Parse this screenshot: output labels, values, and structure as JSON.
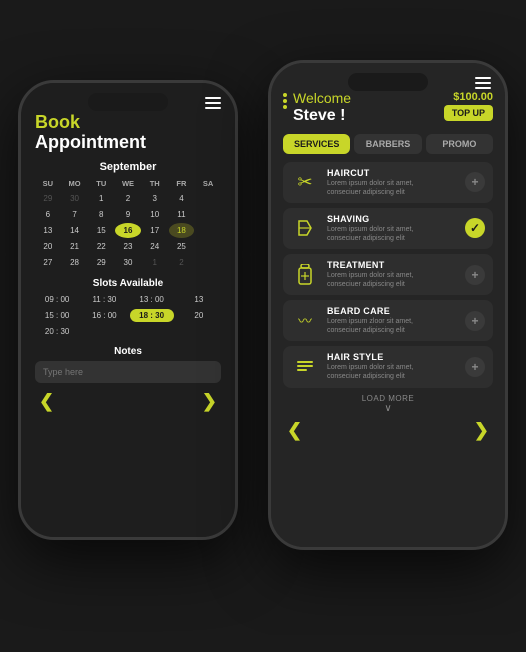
{
  "phone1": {
    "title_book": "Book",
    "title_appointment": "Appointment",
    "calendar": {
      "month": "September",
      "headers": [
        "SU",
        "MO",
        "TU",
        "WE",
        "TH",
        "FR",
        "SA"
      ],
      "weeks": [
        [
          "29",
          "30",
          "1",
          "2",
          "3",
          "4",
          ""
        ],
        [
          "6",
          "7",
          "8",
          "9",
          "10",
          "11",
          ""
        ],
        [
          "13",
          "14",
          "15",
          "16",
          "17",
          "18",
          ""
        ],
        [
          "20",
          "21",
          "22",
          "23",
          "24",
          "25",
          ""
        ],
        [
          "27",
          "28",
          "29",
          "30",
          "1",
          "2",
          ""
        ]
      ],
      "selected_day": "16",
      "highlighted_day": "18"
    },
    "slots_title": "Slots Available",
    "slots": [
      {
        "time": "09 : 00",
        "selected": false
      },
      {
        "time": "11 : 30",
        "selected": false
      },
      {
        "time": "13 : 00",
        "selected": false
      },
      {
        "time": "13",
        "selected": false
      },
      {
        "time": "15 : 00",
        "selected": false
      },
      {
        "time": "16 : 00",
        "selected": false
      },
      {
        "time": "18 : 30",
        "selected": true
      },
      {
        "time": "20",
        "selected": false
      },
      {
        "time": "20 : 30",
        "selected": false
      }
    ],
    "notes_title": "Notes",
    "notes_placeholder": "Type here"
  },
  "phone2": {
    "welcome_label": "Welcome",
    "welcome_name": "Steve !",
    "balance": "$100.00",
    "top_up": "TOP UP",
    "tabs": [
      {
        "label": "SERVICES",
        "active": true
      },
      {
        "label": "BARBERS",
        "active": false
      },
      {
        "label": "PROMO",
        "active": false
      }
    ],
    "services": [
      {
        "name": "HAIRCUT",
        "desc": "Lorem ipsum dolor sit amet,\nconseciuer adipiscing elit",
        "icon": "✂",
        "action": "add",
        "selected": false
      },
      {
        "name": "SHAVING",
        "desc": "Lorem ipsum dolor sit amet,\nconseciuer adipiscing elit",
        "icon": "🪒",
        "action": "check",
        "selected": true
      },
      {
        "name": "TREATMENT",
        "desc": "Lorem ipsum dolor sit amet,\nconseciuer adipiscing elit",
        "icon": "💊",
        "action": "add",
        "selected": false
      },
      {
        "name": "BEARD CARE",
        "desc": "Lorem ipsum zloor sit amet,\nconseciuer adipiscing elit",
        "icon": "〰",
        "action": "add",
        "selected": false
      },
      {
        "name": "HAIR STYLE",
        "desc": "Lorem ipsum dolor sit amet,\nconseciuer adipiscing elit",
        "icon": "🪮",
        "action": "add",
        "selected": false
      }
    ],
    "load_more": "LOAD MORE"
  },
  "colors": {
    "accent": "#c8d629",
    "bg_dark": "#1e1e1e",
    "bg_medium": "#2a2a2a",
    "text_muted": "#888888"
  }
}
